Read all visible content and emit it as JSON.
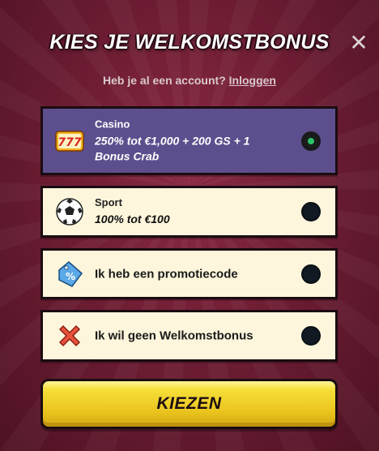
{
  "header": {
    "title": "KIES JE WELKOMSTBONUS",
    "close_icon": "close-icon"
  },
  "account": {
    "prompt": "Heb je al een account?",
    "login_link": "Inloggen"
  },
  "options": [
    {
      "category": "Casino",
      "description": "250% tot €1,000 + 200 GS + 1 Bonus Crab",
      "icon": "slot-777-icon",
      "selected": true
    },
    {
      "category": "Sport",
      "description": "100% tot €100",
      "icon": "soccer-ball-icon",
      "selected": false
    },
    {
      "label": "Ik heb een promotiecode",
      "icon": "percent-tag-icon",
      "selected": false
    },
    {
      "label": "Ik wil geen Welkomstbonus",
      "icon": "red-x-icon",
      "selected": false
    }
  ],
  "submit": {
    "label": "KIEZEN"
  },
  "colors": {
    "background": "#6e1d33",
    "selected_card": "#5d4f8e",
    "card": "#fdf6dc",
    "button": "#f6df3a",
    "radio_active": "#2ec46a"
  }
}
